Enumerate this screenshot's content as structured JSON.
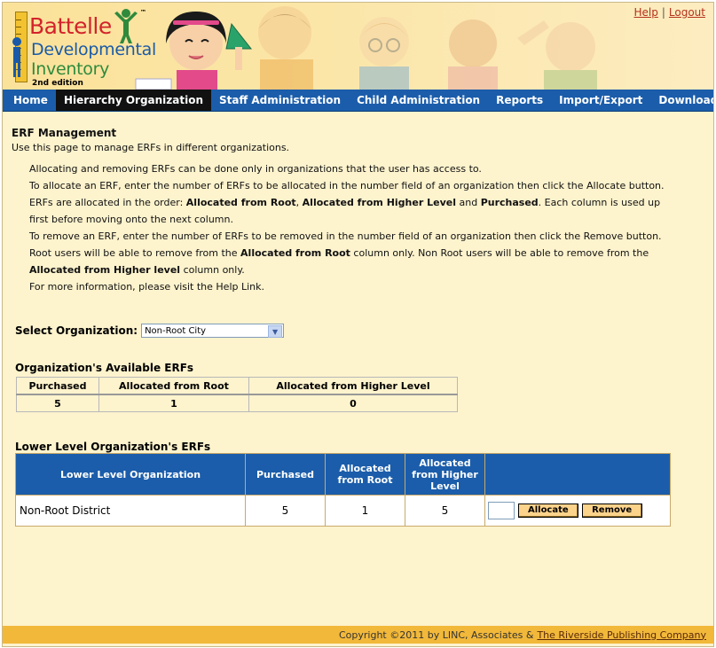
{
  "header": {
    "logo": {
      "line1": "Battelle",
      "line2": "Developmental",
      "line3": "Inventory",
      "edition": "2nd edition",
      "tm": "™"
    },
    "links": {
      "help": "Help",
      "separator": "|",
      "logout": "Logout"
    }
  },
  "nav": {
    "items": [
      {
        "label": "Home"
      },
      {
        "label": "Hierarchy Organization",
        "active": true
      },
      {
        "label": "Staff Administration"
      },
      {
        "label": "Child Administration"
      },
      {
        "label": "Reports"
      },
      {
        "label": "Import/Export"
      },
      {
        "label": "Download"
      }
    ]
  },
  "page": {
    "title": "ERF Management",
    "subtitle": "Use this page to manage ERFs in different organizations.",
    "instructions": {
      "l1": "Allocating and removing ERFs can be done only in organizations that the user has access to.",
      "l2": "To allocate an ERF, enter the number of ERFs to be allocated in the number field of an organization then click the Allocate button.",
      "l3a": "ERFs are allocated in the order: ",
      "l3b": "Allocated from Root",
      "l3c": ", ",
      "l3d": "Allocated from Higher Level",
      "l3e": " and ",
      "l3f": "Purchased",
      "l3g": ". Each column is used up",
      "l4": "first before moving onto the next column.",
      "l5": "To remove an ERF, enter the number of ERFs to be removed in the number field of an organization then click the Remove button.",
      "l6a": "Root users will be able to remove from the ",
      "l6b": "Allocated from Root",
      "l6c": " column only. Non Root users will be able to remove from the",
      "l7a": "Allocated from Higher level",
      "l7b": " column only.",
      "l8": "For more information, please visit the Help Link."
    }
  },
  "select_org": {
    "label": "Select Organization",
    "colon": ":",
    "value": "Non-Root City"
  },
  "available": {
    "title": "Organization's Available ERFs",
    "headers": [
      "Purchased",
      "Allocated from Root",
      "Allocated from Higher Level"
    ],
    "values": [
      "5",
      "1",
      "0"
    ]
  },
  "lower": {
    "title": "Lower Level Organization's ERFs",
    "headers": {
      "org": "Lower Level Organization",
      "purchased": "Purchased",
      "root_1": "Allocated",
      "root_2": "from Root",
      "higher_1": "Allocated",
      "higher_2": "from Higher",
      "higher_3": "Level"
    },
    "rows": [
      {
        "org": "Non-Root District",
        "purchased": "5",
        "root": "1",
        "higher": "5"
      }
    ],
    "allocate_label": "Allocate",
    "remove_label": "Remove"
  },
  "footer": {
    "copyright": "Copyright ©2011 by LINC, Associates &",
    "link": "The Riverside Publishing Company"
  },
  "colors": {
    "nav": "#1b5daa",
    "page_bg": "#fdf3cd",
    "footer": "#f2b83a",
    "button": "#fcd38a",
    "link": "#b5321c"
  }
}
